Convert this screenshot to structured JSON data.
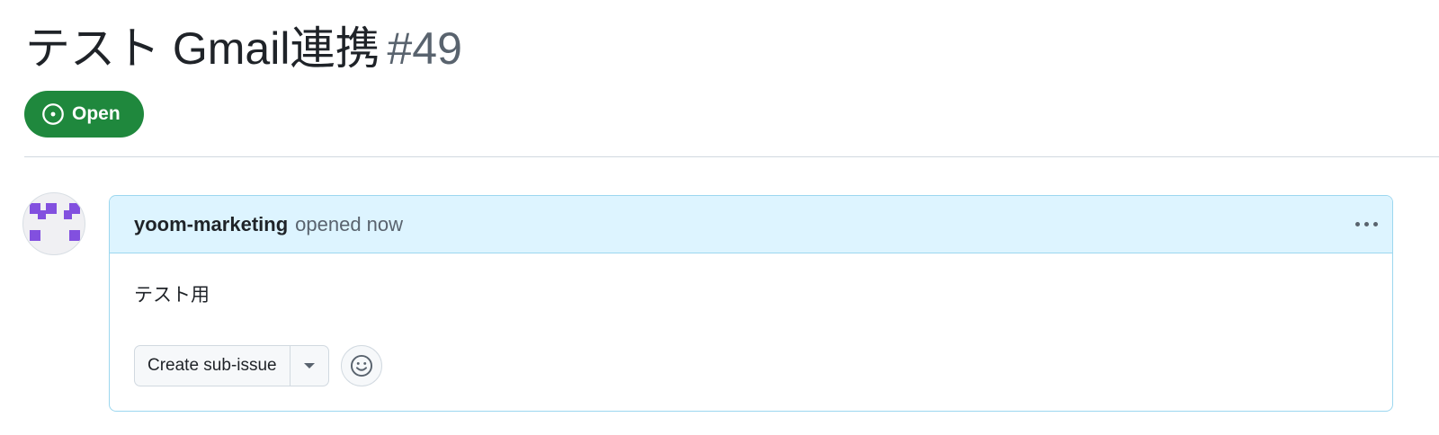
{
  "issue": {
    "title": "テスト Gmail連携",
    "number": "#49",
    "state_label": "Open",
    "state_color": "#1f883d"
  },
  "comment": {
    "author": "yoom-marketing",
    "timestamp": "opened now",
    "body": "テスト用",
    "more_icon": "kebab-horizontal-icon",
    "avatar_color": "#8250df"
  },
  "actions": {
    "create_sub_issue_label": "Create sub-issue",
    "dropdown_icon": "triangle-down-icon",
    "reaction_icon": "smiley-icon"
  }
}
